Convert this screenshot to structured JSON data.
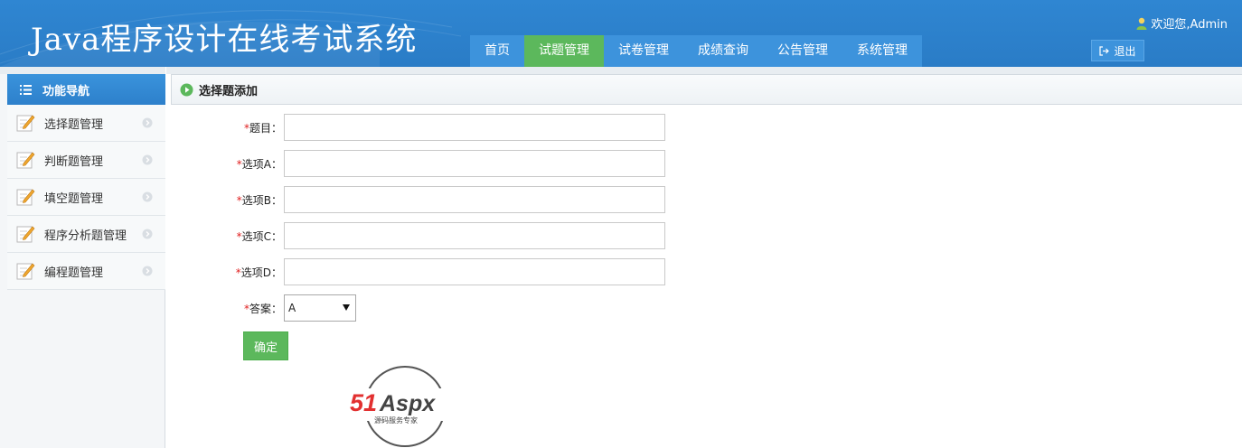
{
  "app": {
    "title": "Java程序设计在线考试系统"
  },
  "nav": {
    "items": [
      {
        "label": "首页",
        "active": false
      },
      {
        "label": "试题管理",
        "active": true
      },
      {
        "label": "试卷管理",
        "active": false
      },
      {
        "label": "成绩查询",
        "active": false
      },
      {
        "label": "公告管理",
        "active": false
      },
      {
        "label": "系统管理",
        "active": false
      }
    ]
  },
  "user": {
    "welcome": "欢迎您,Admin",
    "logout_label": "退出"
  },
  "sidebar": {
    "header": "功能导航",
    "items": [
      {
        "label": "选择题管理"
      },
      {
        "label": "判断题管理"
      },
      {
        "label": "填空题管理"
      },
      {
        "label": "程序分析题管理"
      },
      {
        "label": "编程题管理"
      }
    ]
  },
  "panel": {
    "title": "选择题添加"
  },
  "form": {
    "required_mark": "*",
    "question": {
      "label": "题目：",
      "value": ""
    },
    "option_a": {
      "label": "选项A：",
      "value": ""
    },
    "option_b": {
      "label": "选项B：",
      "value": ""
    },
    "option_c": {
      "label": "选项C：",
      "value": ""
    },
    "option_d": {
      "label": "选项D：",
      "value": ""
    },
    "answer": {
      "label": "答案：",
      "selected": "A"
    },
    "submit_label": "确定"
  },
  "watermark": {
    "brand": "51Aspx",
    "subtitle": "源码服务专家"
  },
  "colors": {
    "header_blue": "#2f86d2",
    "accent_green": "#5cb85c",
    "required_red": "#e02020"
  }
}
